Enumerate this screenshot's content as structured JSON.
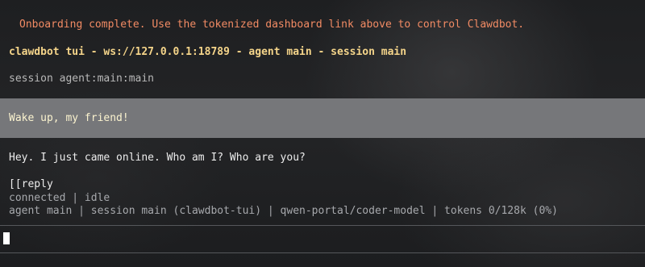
{
  "onboarding_message": "Onboarding complete. Use the tokenized dashboard link above to control Clawdbot.",
  "header": {
    "title": "clawdbot tui - ws://127.0.0.1:18789 - agent main - session main",
    "session_line": "session agent:main:main"
  },
  "chat": {
    "user_message": "Wake up, my friend!",
    "assistant_message": "Hey. I just came online. Who am I? Who are you?",
    "partial_output": "[[reply"
  },
  "status": {
    "connection": "connected | idle",
    "footer": "agent main | session main (clawdbot-tui) | qwen-portal/coder-model | tokens 0/128k (0%)"
  },
  "colors": {
    "onboarding": "#f28b64",
    "title": "#f5d58a",
    "user_block_bg": "#76777a",
    "user_text": "#fbf3cf",
    "muted": "#a7a9ad"
  }
}
